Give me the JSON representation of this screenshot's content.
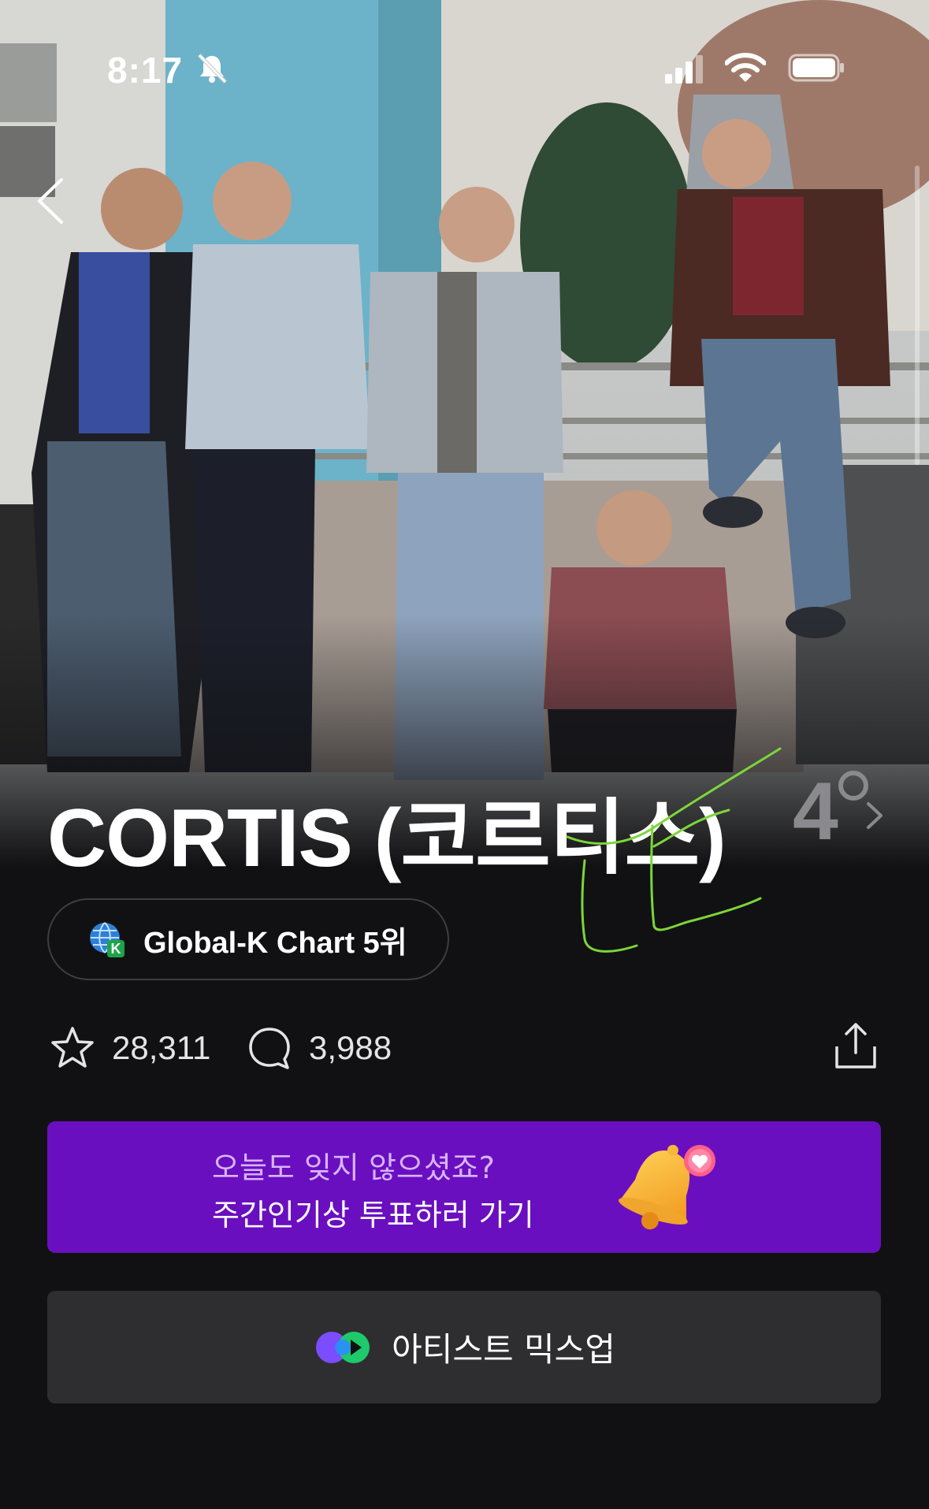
{
  "status_bar": {
    "time": "8:17"
  },
  "artist": {
    "name": "CORTIS (코르티스)",
    "temperature": "4"
  },
  "chart_badge": {
    "label": "Global-K Chart 5위"
  },
  "stats": {
    "favorites": "28,311",
    "comments": "3,988"
  },
  "vote_banner": {
    "line1": "오늘도 잊지 않으셨죠?",
    "line2": "주간인기상 투표하러 가기"
  },
  "mixup": {
    "label": "아티스트 믹스업"
  },
  "colors": {
    "background": "#111113",
    "banner_purple": "#6a0fbf",
    "mixup_button": "#2e2e31",
    "annotation_green": "#7cd63a"
  },
  "icons": [
    "bell-slash-icon",
    "signal-icon",
    "wifi-icon",
    "battery-icon",
    "back-chevron-icon",
    "chevron-right-icon",
    "global-k-icon",
    "star-icon",
    "comment-icon",
    "share-icon",
    "bell-icon",
    "mixup-icon"
  ]
}
